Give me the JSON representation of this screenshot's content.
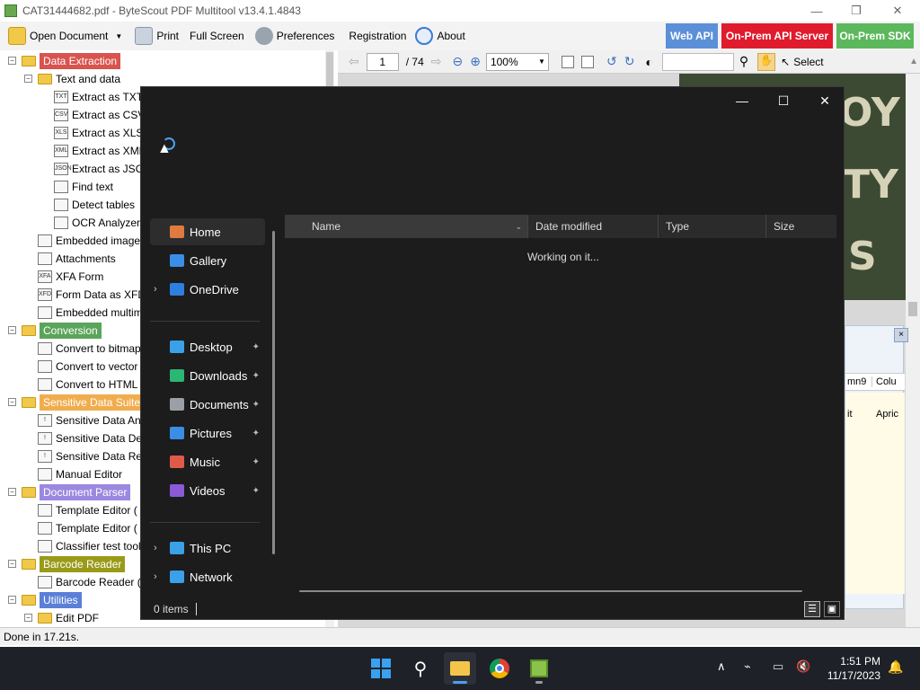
{
  "app": {
    "title": "CAT31444682.pdf - ByteScout PDF Multitool v13.4.1.4843",
    "window_controls": {
      "minimize": "—",
      "maximize": "❐",
      "close": "✕"
    }
  },
  "toolbar": {
    "open_document": "Open Document",
    "print": "Print",
    "full_screen": "Full Screen",
    "preferences": "Preferences",
    "registration": "Registration",
    "about": "About",
    "web_api": "Web API",
    "onprem_api_server": "On-Prem API Server",
    "onprem_sdk": "On-Prem SDK",
    "colors": {
      "web_api": "#5b8fd8",
      "onprem_api_server": "#e01b2d",
      "onprem_sdk": "#5cb85c"
    }
  },
  "viewer": {
    "page_input": "1",
    "page_total": "/ 74",
    "zoom": "100%",
    "select": "Select"
  },
  "doc_letters": [
    "OY",
    "TY",
    "S"
  ],
  "side_panel": {
    "close": "×",
    "col1": "mn9",
    "col2": "Colu",
    "cell1": "it",
    "cell2": "Apric"
  },
  "tree": {
    "items": [
      {
        "label": "Data Extraction",
        "kind": "category",
        "color": "#d9534f",
        "icon": "folder"
      },
      {
        "label": "Text and data",
        "kind": "folder",
        "icon": "folder"
      },
      {
        "label": "Extract as TXT",
        "kind": "leaf",
        "icon": "txt-icon",
        "icon_text": "TXT"
      },
      {
        "label": "Extract as CSV",
        "kind": "leaf",
        "icon": "csv-icon",
        "icon_text": "CSV"
      },
      {
        "label": "Extract as XLS",
        "kind": "leaf",
        "icon": "xls-icon",
        "icon_text": "XLS"
      },
      {
        "label": "Extract as XML",
        "kind": "leaf",
        "icon": "xml-icon",
        "icon_text": "XML"
      },
      {
        "label": "Extract as JSON",
        "kind": "leaf",
        "icon": "json-icon",
        "icon_text": "JSON"
      },
      {
        "label": "Find text",
        "kind": "leaf",
        "icon": "binoculars-icon",
        "icon_text": ""
      },
      {
        "label": "Detect tables",
        "kind": "leaf",
        "icon": "table-icon",
        "icon_text": ""
      },
      {
        "label": "OCR Analyzer",
        "kind": "leaf",
        "icon": "ocr-icon",
        "icon_text": ""
      },
      {
        "label": "Embedded images",
        "kind": "leaf",
        "icon": "image-icon",
        "icon_text": ""
      },
      {
        "label": "Attachments",
        "kind": "leaf",
        "icon": "paperclip-icon",
        "icon_text": ""
      },
      {
        "label": "XFA Form",
        "kind": "leaf",
        "icon": "xfa-icon",
        "icon_text": "XFA"
      },
      {
        "label": "Form Data as XFDF",
        "kind": "leaf",
        "icon": "xfdf-icon",
        "icon_text": "XFD"
      },
      {
        "label": "Embedded multimedia",
        "kind": "leaf",
        "icon": "multimedia-icon",
        "icon_text": ""
      },
      {
        "label": "Conversion",
        "kind": "category",
        "color": "#5aa55a",
        "icon": "folder"
      },
      {
        "label": "Convert to bitmap",
        "kind": "leaf",
        "icon": "bitmap-icon",
        "icon_text": ""
      },
      {
        "label": "Convert to vector",
        "kind": "leaf",
        "icon": "vector-icon",
        "icon_text": ""
      },
      {
        "label": "Convert to HTML",
        "kind": "leaf",
        "icon": "html-icon",
        "icon_text": ""
      },
      {
        "label": "Sensitive Data Suite",
        "kind": "category",
        "color": "#f0ad4e",
        "icon": "folder"
      },
      {
        "label": "Sensitive Data Analyzer",
        "kind": "leaf",
        "icon": "info-icon",
        "icon_text": "!"
      },
      {
        "label": "Sensitive Data Detector",
        "kind": "leaf",
        "icon": "warning-icon",
        "icon_text": "!"
      },
      {
        "label": "Sensitive Data Remover",
        "kind": "leaf",
        "icon": "shield-icon",
        "icon_text": "!"
      },
      {
        "label": "Manual Editor",
        "kind": "leaf",
        "icon": "editor-icon",
        "icon_text": ""
      },
      {
        "label": "Document Parser",
        "kind": "category",
        "color": "#9b88e0",
        "icon": "folder"
      },
      {
        "label": "Template Editor (",
        "kind": "leaf",
        "icon": "template-icon",
        "icon_text": ""
      },
      {
        "label": "Template Editor (",
        "kind": "leaf",
        "icon": "template-icon",
        "icon_text": ""
      },
      {
        "label": "Classifier test tool",
        "kind": "leaf",
        "icon": "classifier-icon",
        "icon_text": ""
      },
      {
        "label": "Barcode Reader",
        "kind": "category",
        "color": "#9a9a1a",
        "icon": "folder"
      },
      {
        "label": "Barcode Reader (I",
        "kind": "leaf",
        "icon": "barcode-icon",
        "icon_text": ""
      },
      {
        "label": "Utilities",
        "kind": "category",
        "color": "#5b7fd8",
        "icon": "folder"
      },
      {
        "label": "Edit PDF",
        "kind": "folder",
        "icon": "folder"
      }
    ]
  },
  "status": {
    "text": "Done in 17.21s."
  },
  "dialog": {
    "controls": {
      "minimize": "—",
      "maximize": "☐",
      "close": "✕"
    },
    "nav": [
      {
        "label": "Home",
        "icon": "home-icon",
        "color": "#e07a3f",
        "pinned": false,
        "chevron": false
      },
      {
        "label": "Gallery",
        "icon": "gallery-icon",
        "color": "#3a8ee6",
        "pinned": false,
        "chevron": false
      },
      {
        "label": "OneDrive",
        "icon": "cloud-icon",
        "color": "#2d7fe0",
        "pinned": false,
        "chevron": true
      },
      {
        "label": "Desktop",
        "icon": "desktop-icon",
        "color": "#3aa0e8",
        "pinned": true,
        "chevron": false
      },
      {
        "label": "Downloads",
        "icon": "download-icon",
        "color": "#2bb673",
        "pinned": true,
        "chevron": false
      },
      {
        "label": "Documents",
        "icon": "documents-icon",
        "color": "#9aa0a6",
        "pinned": true,
        "chevron": false
      },
      {
        "label": "Pictures",
        "icon": "pictures-icon",
        "color": "#3a8ee6",
        "pinned": true,
        "chevron": false
      },
      {
        "label": "Music",
        "icon": "music-icon",
        "color": "#e05a4a",
        "pinned": true,
        "chevron": false
      },
      {
        "label": "Videos",
        "icon": "videos-icon",
        "color": "#8a5ad8",
        "pinned": true,
        "chevron": false
      },
      {
        "label": "This PC",
        "icon": "pc-icon",
        "color": "#3aa0e8",
        "pinned": false,
        "chevron": true
      },
      {
        "label": "Network",
        "icon": "network-icon",
        "color": "#3aa0e8",
        "pinned": false,
        "chevron": true
      }
    ],
    "columns": [
      "Name",
      "Date modified",
      "Type",
      "Size"
    ],
    "working": "Working on it...",
    "item_count": "0 items"
  },
  "taskbar": {
    "time": "1:51 PM",
    "date": "11/17/2023"
  }
}
